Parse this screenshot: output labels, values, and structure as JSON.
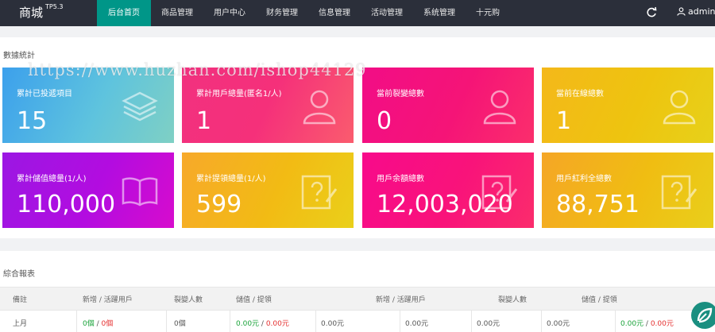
{
  "header": {
    "brand": "商城",
    "version": "TP5.3",
    "nav": [
      "后台首页",
      "商品管理",
      "用户中心",
      "财务管理",
      "信息管理",
      "活动管理",
      "系统管理",
      "十元购"
    ],
    "user": "admin"
  },
  "stats": {
    "title": "數據統計",
    "watermark": "https://www.huzhan.com/ishop44129",
    "cards": [
      {
        "label": "累計已投遞項目",
        "value": "15",
        "icon": "layers-icon"
      },
      {
        "label": "累計用戶總量(匿名1/人)",
        "value": "1",
        "icon": "user-icon"
      },
      {
        "label": "當前裂變總數",
        "value": "0",
        "icon": "user-icon"
      },
      {
        "label": "當前在線總數",
        "value": "1",
        "icon": "user-icon"
      },
      {
        "label": "累計儲值總量(1/人)",
        "value": "110,000",
        "icon": "book-icon"
      },
      {
        "label": "累計提領總量(1/人)",
        "value": "599",
        "icon": "edit-icon"
      },
      {
        "label": "用戶余額總數",
        "value": "12,003,020",
        "icon": "edit-icon"
      },
      {
        "label": "用戶紅利全總數",
        "value": "88,751",
        "icon": "edit-icon"
      }
    ]
  },
  "report": {
    "title": "綜合報表",
    "headers": [
      "備註",
      "新增 / 活躍用戶",
      "裂變人數",
      "儲值 / 提領",
      "新增 / 活躍用戶",
      "裂變人數",
      "儲值 / 提領"
    ],
    "row": {
      "label": "上月",
      "new_users": "0個",
      "active_users": "0個",
      "fission": "0個",
      "deposit": "0.00元",
      "withdraw": "0.00元",
      "c5": "0.00元",
      "c6": "0.00元",
      "c7": "0.00元",
      "c8": "0.00元",
      "c9a": "0.00元",
      "c9b": "0.00元"
    }
  }
}
